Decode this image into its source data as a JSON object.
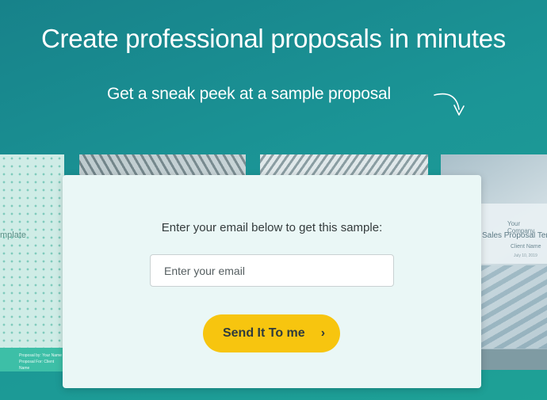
{
  "hero": {
    "headline": "Create professional proposals in minutes",
    "subhead": "Get a sneak peek at a sample proposal",
    "arrow_icon": "curved-arrow-down-icon"
  },
  "previews": {
    "card1": {
      "title": "mplate",
      "footer_line1": "Proposal by: Your Name",
      "footer_line2": "Proposal For: Client Name"
    },
    "card4": {
      "company": "Your Company",
      "title": "Sales Proposal Tem",
      "client": "Client Name",
      "date": "July 10, 2019"
    }
  },
  "form": {
    "prompt": "Enter your email below to get this sample:",
    "email_placeholder": "Enter your email",
    "email_value": "",
    "submit_label": "Send It To me",
    "submit_icon": "›"
  },
  "colors": {
    "background": "#1b9596",
    "button": "#f7c50f",
    "card": "#eaf7f6"
  }
}
